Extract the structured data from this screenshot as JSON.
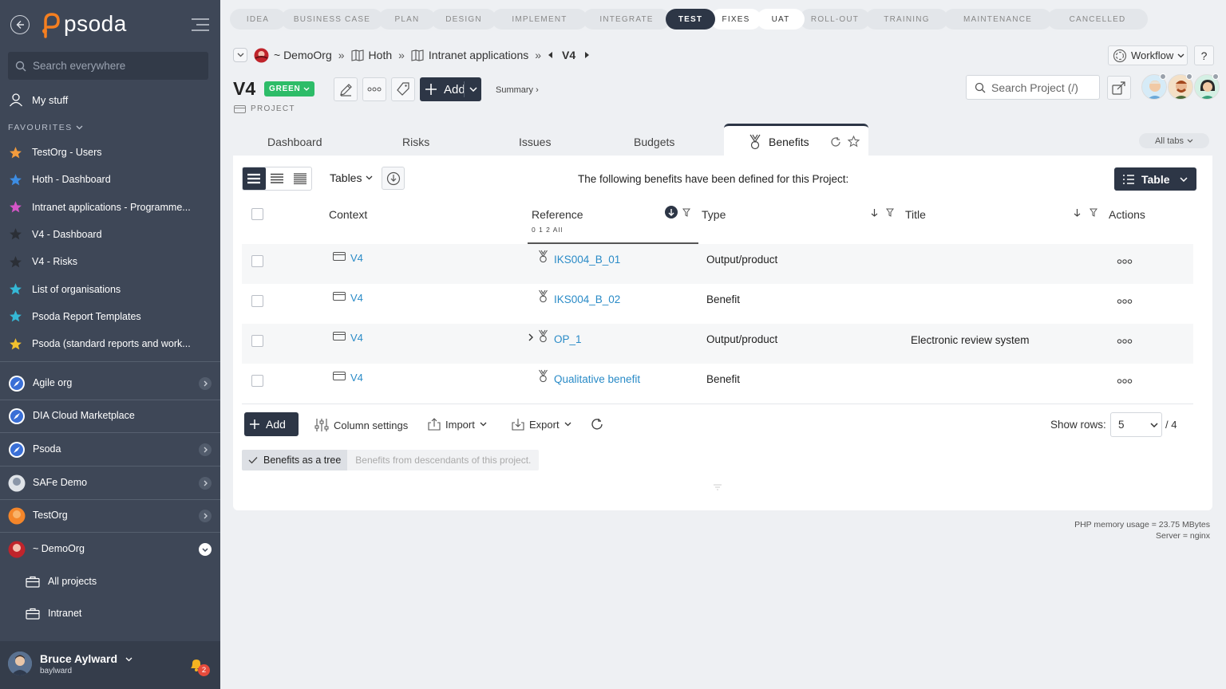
{
  "sidebar": {
    "logo": "psoda",
    "search_placeholder": "Search everywhere",
    "my_stuff": "My stuff",
    "favourites_title": "FAVOURITES",
    "favourites": [
      {
        "label": "TestOrg - Users",
        "color": "#f39c3d"
      },
      {
        "label": "Hoth - Dashboard",
        "color": "#3d8de3"
      },
      {
        "label": "Intranet applications - Programme...",
        "color": "#d456c8"
      },
      {
        "label": "V4 - Dashboard",
        "color": "#2b2f36"
      },
      {
        "label": "V4 - Risks",
        "color": "#2b2f36"
      },
      {
        "label": "List of organisations",
        "color": "#35b8d6"
      },
      {
        "label": "Psoda Report Templates",
        "color": "#35b8d6"
      },
      {
        "label": "Psoda (standard reports and work...",
        "color": "#f2c12e"
      }
    ],
    "orgs": [
      {
        "label": "Agile org"
      },
      {
        "label": "DIA Cloud Marketplace"
      },
      {
        "label": "Psoda"
      },
      {
        "label": "SAFe Demo"
      },
      {
        "label": "TestOrg"
      },
      {
        "label": "~ DemoOrg"
      }
    ],
    "sub_items": [
      {
        "label": "All projects"
      },
      {
        "label": "Intranet"
      }
    ],
    "user_name": "Bruce Aylward",
    "user_login": "baylward",
    "notif_count": "2"
  },
  "stages": [
    {
      "label": "IDEA",
      "state": "todo"
    },
    {
      "label": "BUSINESS CASE",
      "state": "todo"
    },
    {
      "label": "PLAN",
      "state": "todo"
    },
    {
      "label": "DESIGN",
      "state": "todo"
    },
    {
      "label": "IMPLEMENT",
      "state": "todo"
    },
    {
      "label": "INTEGRATE",
      "state": "todo"
    },
    {
      "label": "TEST",
      "state": "active"
    },
    {
      "label": "FIXES",
      "state": "done"
    },
    {
      "label": "UAT",
      "state": "done"
    },
    {
      "label": "ROLL-OUT",
      "state": "todo"
    },
    {
      "label": "TRAINING",
      "state": "todo"
    },
    {
      "label": "MAINTENANCE",
      "state": "todo"
    },
    {
      "label": "CANCELLED",
      "state": "todo"
    }
  ],
  "breadcrumb": {
    "org": "~ DemoOrg",
    "programme": "Hoth",
    "portfolio": "Intranet applications",
    "project": "V4"
  },
  "header": {
    "title": "V4",
    "status": "GREEN",
    "type": "PROJECT",
    "add_label": "Add",
    "summary_link": "Summary ›",
    "workflow_label": "Workflow",
    "help": "?",
    "search_placeholder": "Search Project (/)"
  },
  "tabs": {
    "items": [
      "Dashboard",
      "Risks",
      "Issues",
      "Budgets"
    ],
    "active": "Benefits",
    "all_tabs": "All tabs"
  },
  "toolbar": {
    "tables_label": "Tables",
    "intro": "The following benefits have been defined for this Project:",
    "table_view": "Table"
  },
  "table": {
    "columns": [
      "Context",
      "Reference",
      "Type",
      "Title",
      "Actions"
    ],
    "ref_filters": "0 1 2 All",
    "rows": [
      {
        "context": "V4",
        "reference": "IKS004_B_01",
        "type": "Output/product",
        "title": "",
        "expandable": false
      },
      {
        "context": "V4",
        "reference": "IKS004_B_02",
        "type": "Benefit",
        "title": "",
        "expandable": false
      },
      {
        "context": "V4",
        "reference": "OP_1",
        "type": "Output/product",
        "title": "Electronic review system",
        "expandable": true
      },
      {
        "context": "V4",
        "reference": "Qualitative benefit",
        "type": "Benefit",
        "title": "",
        "expandable": false
      }
    ]
  },
  "footer_tools": {
    "add": "Add",
    "column_settings": "Column settings",
    "import": "Import",
    "export": "Export",
    "show_rows_label": "Show rows:",
    "rows_value": "5",
    "rows_total": "/ 4"
  },
  "tree_toggle": {
    "on": "Benefits as a tree",
    "off": "Benefits from descendants of this project."
  },
  "server": {
    "memory": "PHP memory usage = 23.75 MBytes",
    "server": "Server = nginx"
  }
}
